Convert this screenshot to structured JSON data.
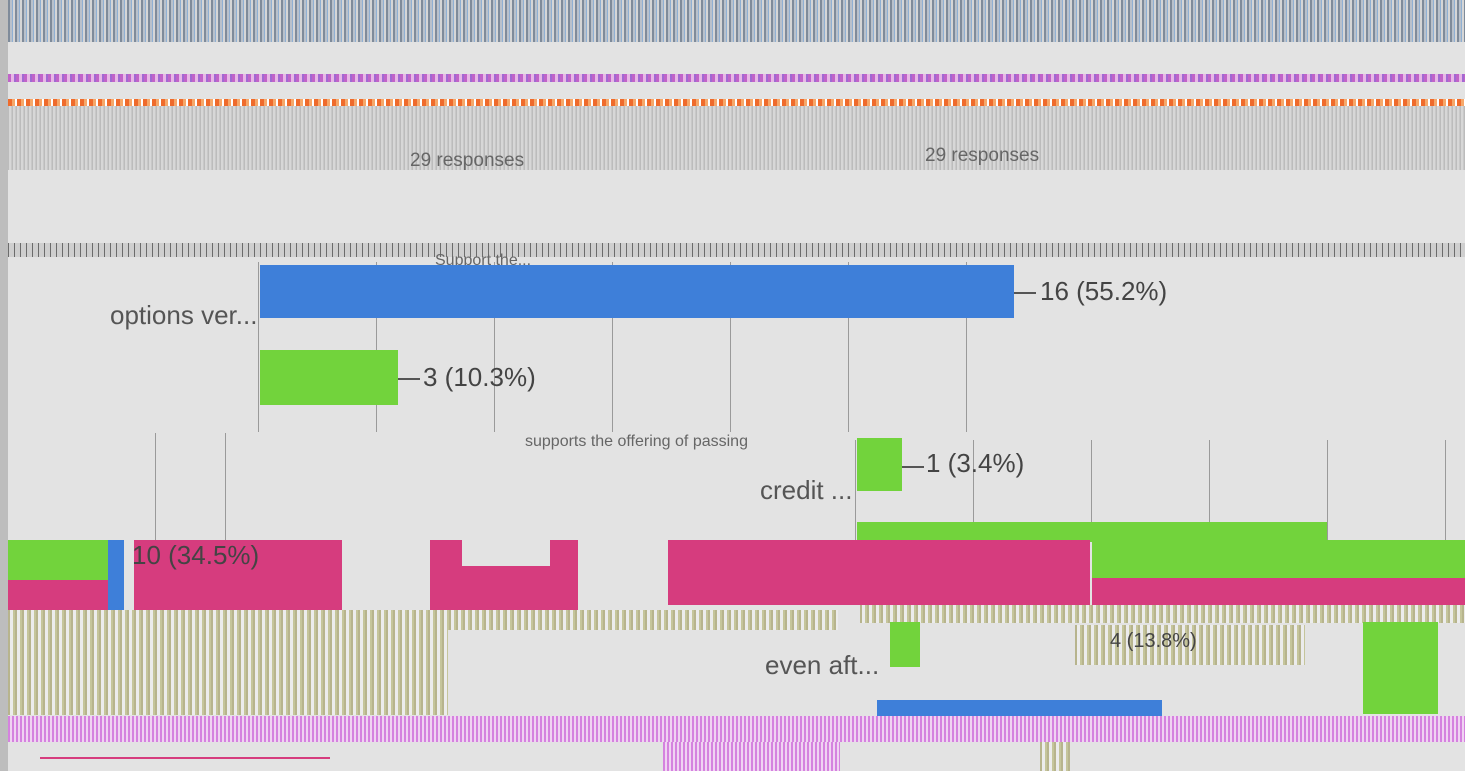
{
  "survey": {
    "header_text": "",
    "response_counts": [
      "29 responses",
      "29 responses"
    ]
  },
  "charts": [
    {
      "fragment_label": "options ver...",
      "top_text": "Support the...",
      "value_label": "16 (55.2%)",
      "value": 16,
      "percent": 55.2,
      "color": "#3e7fd9"
    },
    {
      "fragment_label": "",
      "value_label": "3 (10.3%)",
      "value": 3,
      "percent": 10.3,
      "color": "#72d33c"
    },
    {
      "fragment_label": "credit ...",
      "top_text": "supports the offering of passing",
      "value_label": "1 (3.4%)",
      "value": 1,
      "percent": 3.4,
      "color": "#72d33c"
    },
    {
      "fragment_label": "",
      "value_label": "10 (34.5%)",
      "value": 10,
      "percent": 34.5,
      "color": "#d63c7e"
    },
    {
      "fragment_label": "even aft...",
      "value_label": "4 (13.8%)",
      "value": 4,
      "percent": 13.8,
      "color": "#72d33c"
    }
  ],
  "colors": {
    "blue": "#3e7fd9",
    "green": "#72d33c",
    "pink": "#d63c7e",
    "background": "#e3e3e3"
  }
}
